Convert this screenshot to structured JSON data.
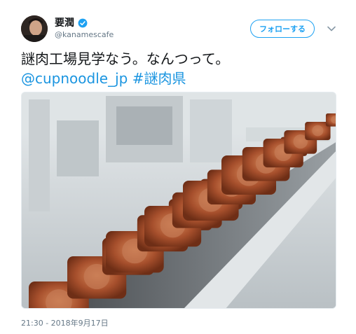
{
  "author": {
    "display_name": "要潤",
    "handle": "@kanamescafe",
    "verified": true,
    "avatar_icon": "user-avatar"
  },
  "follow_button": {
    "label": "フォローする"
  },
  "menu_icon": "chevron-down-icon",
  "tweet": {
    "text_line1": "謎肉工場見学なう。なんつって。",
    "mention": "@cupnoodle_jp",
    "hashtag": "#謎肉県"
  },
  "media": {
    "description_icon": "photo",
    "rows": 6
  },
  "timestamp": "21:30 - 2018年9月17日",
  "colors": {
    "accent": "#1da1f2",
    "link": "#1b95e0",
    "secondary_text": "#657786"
  }
}
